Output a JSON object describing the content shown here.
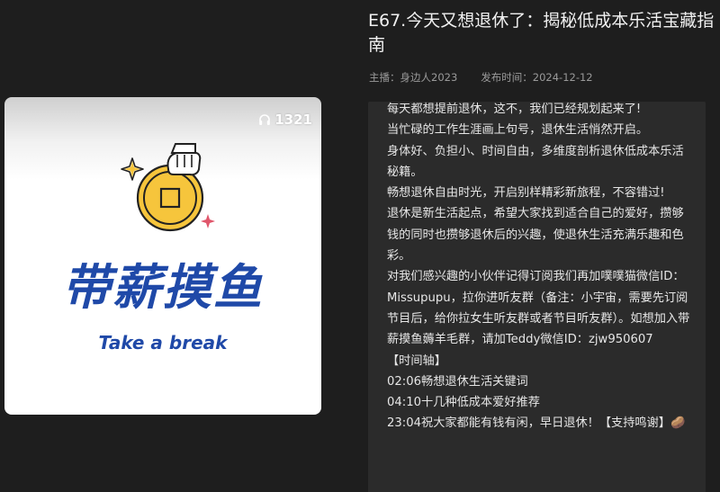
{
  "episode": {
    "title": "E67.今天又想退休了：揭秘低成本乐活宝藏指南",
    "host_label": "主播：",
    "host_name": "身边人2023",
    "date_label": "发布时间：",
    "date_value": "2024-12-12"
  },
  "cover": {
    "listen_count": "1321",
    "brand_title": "带薪摸鱼",
    "brand_subtitle": "Take a break",
    "accent_color": "#1f49a8",
    "coin_color": "#f6c53c"
  },
  "description": {
    "lines": [
      "每天都想提前退休，这不，我们已经规划起来了!",
      "当忙碌的工作生涯画上句号，退休生活悄然开启。",
      "身体好、负担小、时间自由，多维度剖析退休低成本乐活秘籍。",
      "畅想退休自由时光，开启别样精彩新旅程，不容错过!",
      "退休是新生活起点，希望大家找到适合自己的爱好，攒够钱的同时也攒够退休后的兴趣，使退休生活充满乐趣和色彩。",
      "对我们感兴趣的小伙伴记得订阅我们再加噗噗猫微信ID：Missupupu，拉你进听友群（备注：小宇宙，需要先订阅节目后，给你拉女生听友群或者节目听友群）。如想加入带薪摸鱼薅羊毛群，请加Teddy微信ID：zjw950607",
      "【时间轴】",
      "02:06畅想退休生活关键词",
      "04:10十几种低成本爱好推荐",
      "23:04祝大家都能有钱有闲，早日退休！【支持鸣谢】🥔"
    ]
  }
}
